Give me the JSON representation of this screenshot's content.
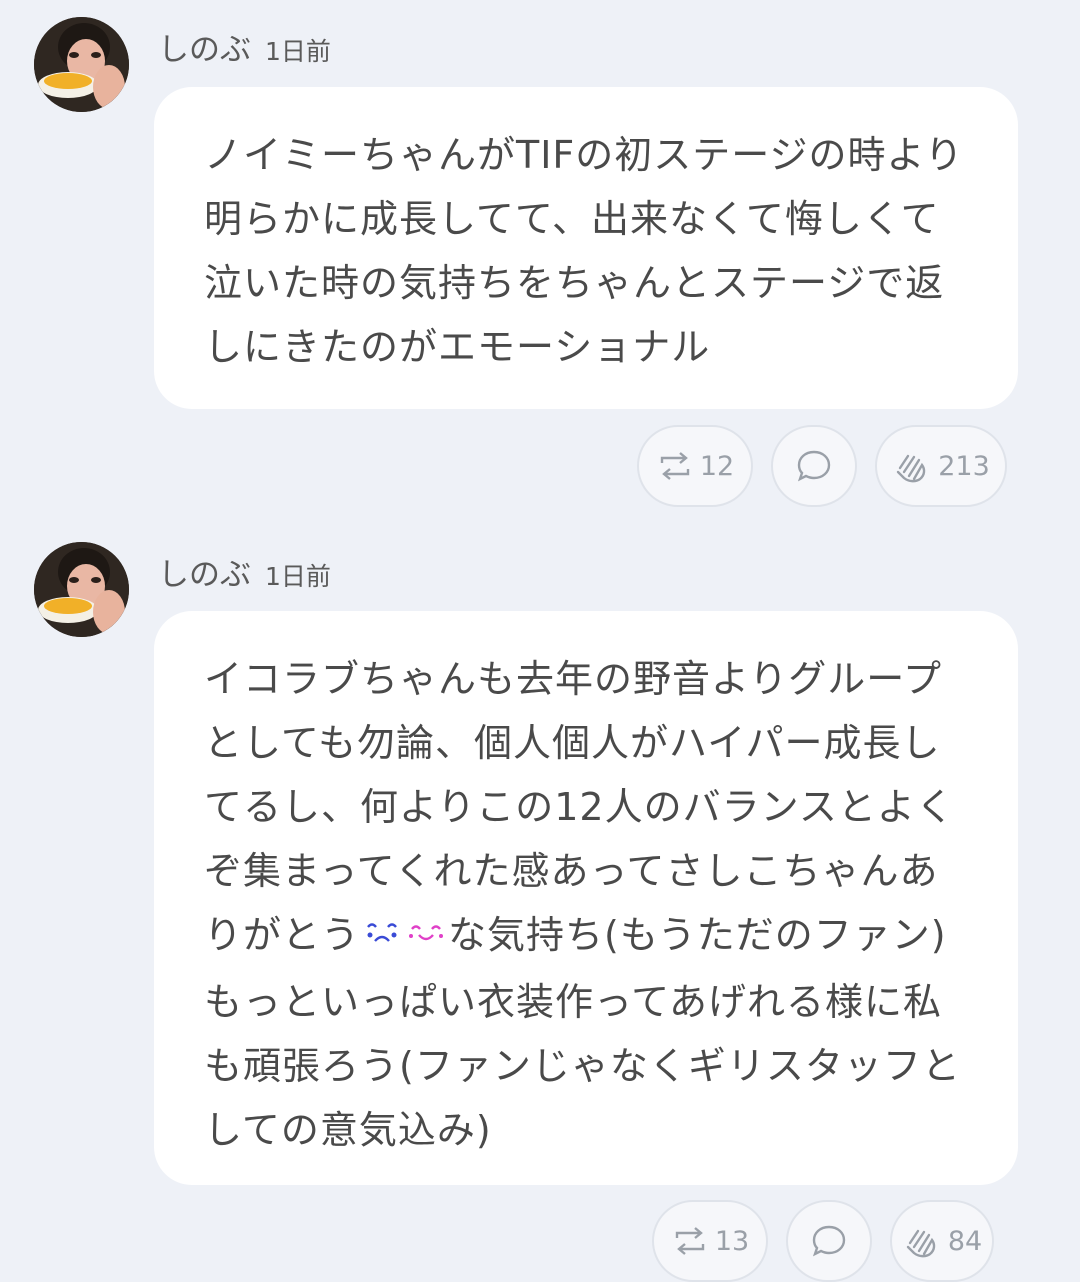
{
  "posts": [
    {
      "author": "しのぶ",
      "time": "1日前",
      "text": "ノイミーちゃんがTIFの初ステージの時より明らかに成長してて、出来なくて悔しくて泣いた時の気持ちをちゃんとステージで返しにきたのがエモーショナル",
      "repost_count": "12",
      "clap_count": "213"
    },
    {
      "author": "しのぶ",
      "time": "1日前",
      "text_before_emoji": "イコラブちゃんも去年の野音よりグループとしても勿論、個人個人がハイパー成長してるし、何よりこの12人のバランスとよくぞ集まってくれた感あってさしこちゃんありがとう",
      "emoji_1": "crying-face",
      "emoji_2": "smiling-face",
      "text_after_emoji": "な気持ち(もうただのファン)もっといっぱい衣装作ってあげれる様に私も頑張ろう(ファンじゃなくギリスタッフとしての意気込み)",
      "repost_count": "13",
      "clap_count": "84"
    }
  ],
  "icons": {
    "repost": "repost-icon",
    "comment": "comment-icon",
    "clap": "clap-icon"
  },
  "colors": {
    "background": "#eef1f7",
    "bubble": "#ffffff",
    "text": "#4a4a4a",
    "action_text": "#9aa0a8",
    "emoji_1": "#3a4bd6",
    "emoji_2": "#e040c8"
  }
}
